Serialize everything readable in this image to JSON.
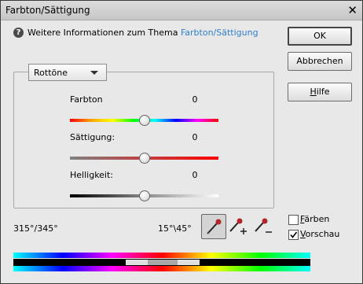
{
  "window": {
    "title": "Farbton/Sättigung"
  },
  "info": {
    "text": "Weitere Informationen zum Thema ",
    "link": "Farbton/Sättigung"
  },
  "buttons": {
    "ok": "OK",
    "cancel": "Abbrechen",
    "help_first": "H",
    "help_rest": "ilfe"
  },
  "range_select": {
    "selected": "Rottöne"
  },
  "sliders": [
    {
      "label": "Farbton",
      "value": "0",
      "level": 0.5
    },
    {
      "label": "Sättigung:",
      "value": "0",
      "level": 0.5
    },
    {
      "label": "Helligkeit:",
      "value": "0",
      "level": 0.5
    }
  ],
  "ranges": {
    "left": "315°/345°",
    "right": "15°\\45°"
  },
  "tools": [
    "eyedropper-icon",
    "eyedropper-add-icon",
    "eyedropper-subtract-icon"
  ],
  "options": {
    "colorize": {
      "label_first": "F",
      "label_rest": "ärben",
      "checked": false
    },
    "preview": {
      "label_first": "V",
      "label_rest": "orschau",
      "checked": true
    }
  },
  "colors": {
    "link": "#2f7fc8",
    "dialog_bg": "#e8e8e8"
  }
}
